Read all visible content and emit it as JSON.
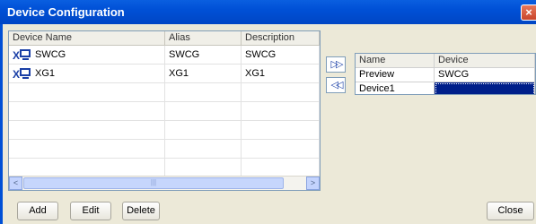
{
  "window": {
    "title": "Device Configuration",
    "close_glyph": "×"
  },
  "devices_table": {
    "headers": [
      "Device Name",
      "Alias",
      "Description"
    ],
    "rows": [
      {
        "name": "SWCG",
        "alias": "SWCG",
        "description": "SWCG",
        "icon": "device-monitor-icon"
      },
      {
        "name": "XG1",
        "alias": "XG1",
        "description": "XG1",
        "icon": "device-monitor-icon"
      }
    ],
    "empty_rows": 6
  },
  "arrows": {
    "add_all": "▷▷",
    "remove_all": "◁◁"
  },
  "assignment_table": {
    "headers": [
      "Name",
      "Device"
    ],
    "rows": [
      {
        "name": "Preview",
        "device": "SWCG"
      },
      {
        "name": "Device1",
        "device": ""
      }
    ]
  },
  "buttons": {
    "add": "Add",
    "edit": "Edit",
    "delete": "Delete",
    "close": "Close"
  },
  "scrollbar": {
    "left": "<",
    "right": ">",
    "grip": "|||"
  }
}
